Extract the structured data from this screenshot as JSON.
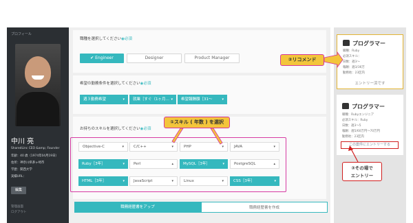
{
  "sidebar": {
    "header": "プロフィール",
    "name": "中川 亮",
    "lines": [
      "SharedLinc CEO &amp; Founder",
      "年齢：40 歳（1974年04月19日）",
      "住所：神奈川県茅ヶ崎市",
      "学歴：関西大学",
      "実績URL："
    ],
    "edit_label": "編集",
    "links": [
      "管理画面",
      "ログアウト"
    ]
  },
  "position_section": {
    "label": "職種を選択してください",
    "required": "◉必須",
    "options": [
      {
        "label": "✔ Engineer",
        "selected": true
      },
      {
        "label": "Designer",
        "selected": false
      },
      {
        "label": "Product Manager",
        "selected": false
      }
    ]
  },
  "conditions_section": {
    "label": "希望の勤務条件を選択してください",
    "required": "◉必須",
    "selects": [
      "週３勤務希望",
      "就業［すぐ（1ヶ月…",
      "希望報酬額［31～"
    ]
  },
  "skills_section": {
    "label": "お持ちのスキルを選択してください",
    "required": "◉必須",
    "rows": [
      [
        {
          "label": "Objective-C",
          "selected": false
        },
        {
          "label": "C/C++",
          "selected": false
        },
        {
          "label": "PHP",
          "selected": false
        },
        {
          "label": "JAVA",
          "selected": false
        }
      ],
      [
        {
          "label": "Ruby［3年］",
          "selected": true
        },
        {
          "label": "Perl",
          "selected": false
        },
        {
          "label": "MySQL［3年］",
          "selected": true
        },
        {
          "label": "PostgreSQL",
          "selected": false
        }
      ],
      [
        {
          "label": "HTML［3年］",
          "selected": true
        },
        {
          "label": "JavaScript",
          "selected": false
        },
        {
          "label": "Linux",
          "selected": false
        },
        {
          "label": "CSS［3年］",
          "selected": true
        }
      ]
    ]
  },
  "bottom_tabs": [
    "職務経歴書をアップ",
    "職務経歴書を作成"
  ],
  "callouts": {
    "skills": "①スキル ( 年数 ) を選択",
    "recommend": "②リコメンド",
    "entry_line1": "③その場で",
    "entry_line2": "エントリー"
  },
  "recommendations": [
    {
      "title": "プログラマー",
      "lines": [
        "職種：Ruby",
        "必須スキル：",
        "日数：週3～",
        "報酬：週3/36万",
        "勤務地：23区内"
      ],
      "status": "エントリー済です"
    },
    {
      "title": "プログラマー",
      "lines": [
        "職種：Rubyエンジニア",
        "必須スキル：Ruby",
        "日数：週3～5",
        "報酬：週5/60万円～70万円",
        "勤務地：23区内"
      ],
      "entry_label": "この案件にエントリーする"
    }
  ],
  "colors": {
    "accent": "#35b8be",
    "highlight_border": "#d63aa2",
    "callout_fill": "#f3c53b",
    "entry_red": "#d01c1c",
    "sidebar_bg": "#2b2f33"
  }
}
